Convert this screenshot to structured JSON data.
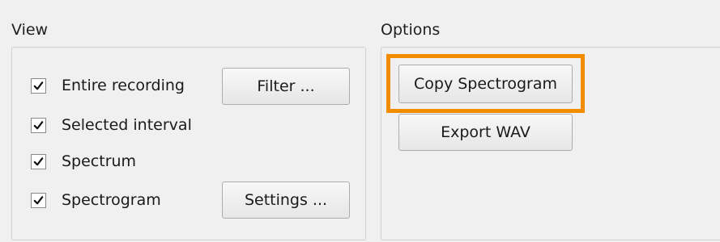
{
  "view": {
    "title": "View",
    "checkboxes": [
      {
        "label": "Entire recording",
        "checked": true
      },
      {
        "label": "Selected interval",
        "checked": true
      },
      {
        "label": "Spectrum",
        "checked": true
      },
      {
        "label": "Spectrogram",
        "checked": true
      }
    ],
    "filter_label": "Filter ...",
    "settings_label": "Settings ..."
  },
  "options": {
    "title": "Options",
    "copy_label": "Copy Spectrogram",
    "export_label": "Export WAV"
  },
  "colors": {
    "highlight": "#f28c00"
  },
  "icons": {
    "check": "checkmark-icon"
  }
}
